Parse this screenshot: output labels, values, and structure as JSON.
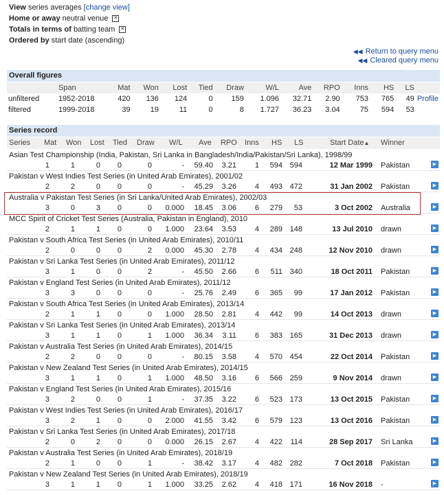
{
  "filters": {
    "view_label": "View",
    "view_value": "series averages",
    "change_view": "[change view]",
    "home_label": "Home or away",
    "home_value": "neutral venue",
    "totals_label": "Totals in terms of",
    "totals_value": "batting team",
    "ordered_label": "Ordered by",
    "ordered_value": "start date (ascending)"
  },
  "links": {
    "return_query": "Return to query menu",
    "cleared_query": "Cleared query menu"
  },
  "overall": {
    "title": "Overall figures",
    "headers": [
      "Span",
      "Mat",
      "Won",
      "Lost",
      "Tied",
      "Draw",
      "W/L",
      "Ave",
      "RPO",
      "Inns",
      "HS",
      "LS"
    ],
    "rows": [
      {
        "label": "unfiltered",
        "cells": [
          "1952-2018",
          "420",
          "136",
          "124",
          "0",
          "159",
          "1.096",
          "32.71",
          "2.90",
          "753",
          "765",
          "49"
        ],
        "profile": "Profile"
      },
      {
        "label": "filtered",
        "cells": [
          "1999-2018",
          "39",
          "19",
          "11",
          "0",
          "8",
          "1.727",
          "36.23",
          "3.04",
          "75",
          "594",
          "53"
        ],
        "profile": ""
      }
    ]
  },
  "series": {
    "title": "Series record",
    "headers": [
      "Series",
      "Mat",
      "Won",
      "Lost",
      "Tied",
      "Draw",
      "W/L",
      "Ave",
      "RPO",
      "Inns",
      "HS",
      "LS",
      "Start Date",
      "Winner"
    ],
    "sort_icon": "sort-down-icon",
    "rows": [
      {
        "name": "Asian Test Championship (India, Pakistan, Sri Lanka in Bangladesh/India/Pakistan/Sri Lanka), 1998/99",
        "v": [
          "1",
          "1",
          "0",
          "0",
          "0",
          "-",
          "59.40",
          "3.21",
          "1",
          "594",
          "594"
        ],
        "date": "12 Mar 1999",
        "winner": "Pakistan"
      },
      {
        "name": "Pakistan v West Indies Test Series (in United Arab Emirates), 2001/02",
        "v": [
          "2",
          "2",
          "0",
          "0",
          "0",
          "-",
          "45.29",
          "3.26",
          "4",
          "493",
          "472"
        ],
        "date": "31 Jan 2002",
        "winner": "Pakistan"
      },
      {
        "name": "Australia v Pakistan Test Series (in Sri Lanka/United Arab Emirates), 2002/03",
        "v": [
          "3",
          "0",
          "3",
          "0",
          "0",
          "0.000",
          "18.45",
          "3.06",
          "6",
          "279",
          "53"
        ],
        "date": "3 Oct 2002",
        "winner": "Australia"
      },
      {
        "name": "MCC Spirit of Cricket Test Series (Australia, Pakistan in England), 2010",
        "v": [
          "2",
          "1",
          "1",
          "0",
          "0",
          "1.000",
          "23.64",
          "3.53",
          "4",
          "289",
          "148"
        ],
        "date": "13 Jul 2010",
        "winner": "drawn"
      },
      {
        "name": "Pakistan v South Africa Test Series (in United Arab Emirates), 2010/11",
        "v": [
          "2",
          "0",
          "0",
          "0",
          "2",
          "0.000",
          "45.30",
          "2.78",
          "4",
          "434",
          "248"
        ],
        "date": "12 Nov 2010",
        "winner": "drawn"
      },
      {
        "name": "Pakistan v Sri Lanka Test Series (in United Arab Emirates), 2011/12",
        "v": [
          "3",
          "1",
          "0",
          "0",
          "2",
          "-",
          "45.50",
          "2.66",
          "6",
          "511",
          "340"
        ],
        "date": "18 Oct 2011",
        "winner": "Pakistan"
      },
      {
        "name": "Pakistan v England Test Series (in United Arab Emirates), 2011/12",
        "v": [
          "3",
          "3",
          "0",
          "0",
          "0",
          "-",
          "25.76",
          "2.49",
          "6",
          "365",
          "99"
        ],
        "date": "17 Jan 2012",
        "winner": "Pakistan"
      },
      {
        "name": "Pakistan v South Africa Test Series (in United Arab Emirates), 2013/14",
        "v": [
          "2",
          "1",
          "1",
          "0",
          "0",
          "1.000",
          "28.50",
          "2.81",
          "4",
          "442",
          "99"
        ],
        "date": "14 Oct 2013",
        "winner": "drawn"
      },
      {
        "name": "Pakistan v Sri Lanka Test Series (in United Arab Emirates), 2013/14",
        "v": [
          "3",
          "1",
          "1",
          "0",
          "1",
          "1.000",
          "36.34",
          "3.11",
          "6",
          "383",
          "165"
        ],
        "date": "31 Dec 2013",
        "winner": "drawn"
      },
      {
        "name": "Pakistan v Australia Test Series (in United Arab Emirates), 2014/15",
        "v": [
          "2",
          "2",
          "0",
          "0",
          "0",
          "-",
          "80.15",
          "3.58",
          "4",
          "570",
          "454"
        ],
        "date": "22 Oct 2014",
        "winner": "Pakistan"
      },
      {
        "name": "Pakistan v New Zealand Test Series (in United Arab Emirates), 2014/15",
        "v": [
          "3",
          "1",
          "1",
          "0",
          "1",
          "1.000",
          "48.50",
          "3.16",
          "6",
          "566",
          "259"
        ],
        "date": "9 Nov 2014",
        "winner": "drawn"
      },
      {
        "name": "Pakistan v England Test Series (in United Arab Emirates), 2015/16",
        "v": [
          "3",
          "2",
          "0",
          "0",
          "1",
          "-",
          "37.35",
          "3.22",
          "6",
          "523",
          "173"
        ],
        "date": "13 Oct 2015",
        "winner": "Pakistan"
      },
      {
        "name": "Pakistan v West Indies Test Series (in United Arab Emirates), 2016/17",
        "v": [
          "3",
          "2",
          "1",
          "0",
          "0",
          "2.000",
          "41.55",
          "3.42",
          "6",
          "579",
          "123"
        ],
        "date": "13 Oct 2016",
        "winner": "Pakistan"
      },
      {
        "name": "Pakistan v Sri Lanka Test Series (in United Arab Emirates), 2017/18",
        "v": [
          "2",
          "0",
          "2",
          "0",
          "0",
          "0.000",
          "26.15",
          "2.67",
          "4",
          "422",
          "114"
        ],
        "date": "28 Sep 2017",
        "winner": "Sri Lanka"
      },
      {
        "name": "Pakistan v Australia Test Series (in United Arab Emirates), 2018/19",
        "v": [
          "2",
          "1",
          "0",
          "0",
          "1",
          "-",
          "38.42",
          "3.17",
          "4",
          "482",
          "282"
        ],
        "date": "7 Oct 2018",
        "winner": "Pakistan"
      },
      {
        "name": "Pakistan v New Zealand Test Series (in United Arab Emirates), 2018/19",
        "v": [
          "3",
          "1",
          "1",
          "0",
          "1",
          "1.000",
          "33.25",
          "2.62",
          "4",
          "418",
          "171"
        ],
        "date": "16 Nov 2018",
        "winner": "-"
      }
    ]
  }
}
